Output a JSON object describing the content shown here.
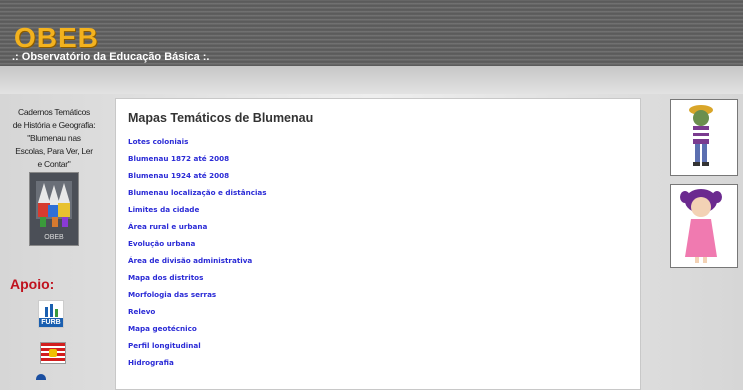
{
  "header": {
    "logo": "OBEB",
    "subtitle": ".: Observatório da Educação Básica :."
  },
  "left": {
    "caderno_lines": [
      "Cadernos Temáticos",
      "de História e Geografia:",
      "\"Blumenau nas",
      "Escolas, Para Ver, Ler",
      "e Contar\""
    ],
    "book_label": "OBEB",
    "apoio": "Apoio:",
    "furb_label": "FURB"
  },
  "main": {
    "title": "Mapas Temáticos de Blumenau",
    "links": [
      "Lotes coloniais",
      "Blumenau 1872 até 2008",
      "Blumenau 1924 até 2008",
      "Blumenau localização e distâncias",
      "Limites da cidade",
      "Área rural e urbana",
      "Evolução urbana",
      "Área de divisão administrativa",
      "Mapa dos distritos",
      "Morfologia das serras",
      "Relevo",
      "Mapa geotécnico",
      "Perfil longitudinal",
      "Hidrografia"
    ]
  },
  "colors": {
    "logo": "#f3b21e",
    "link": "#2b2bd6",
    "apoio": "#c0121e"
  }
}
